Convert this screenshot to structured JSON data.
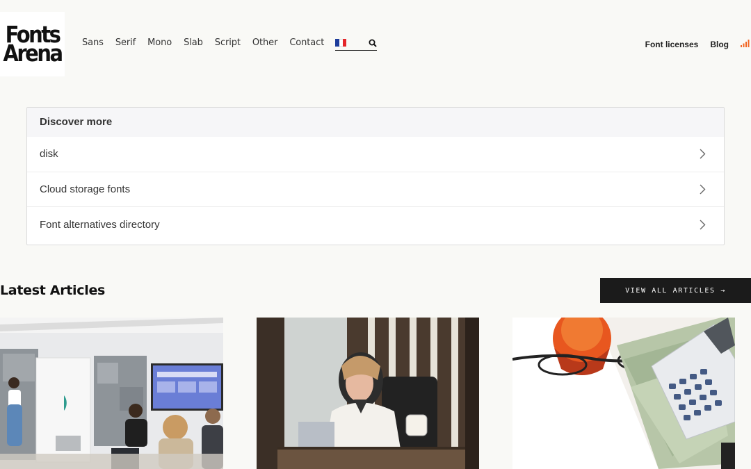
{
  "logo": {
    "line1": "Fonts",
    "line2": "Arena"
  },
  "nav": {
    "items": [
      "Sans",
      "Serif",
      "Mono",
      "Slab",
      "Script",
      "Other",
      "Contact"
    ]
  },
  "language_flag": "france-flag-icon",
  "search": {
    "placeholder": ""
  },
  "right_nav": {
    "items": [
      "Font licenses",
      "Blog"
    ]
  },
  "discover": {
    "title": "Discover more",
    "items": [
      "disk",
      "Cloud storage fonts",
      "Font alternatives directory"
    ]
  },
  "latest": {
    "title": "Latest Articles",
    "view_all_label": "VIEW ALL ARTICLES →"
  },
  "colors": {
    "accent_rss": "#f26522",
    "button_bg": "#1b1b1b",
    "page_bg": "#f9f9f6"
  }
}
